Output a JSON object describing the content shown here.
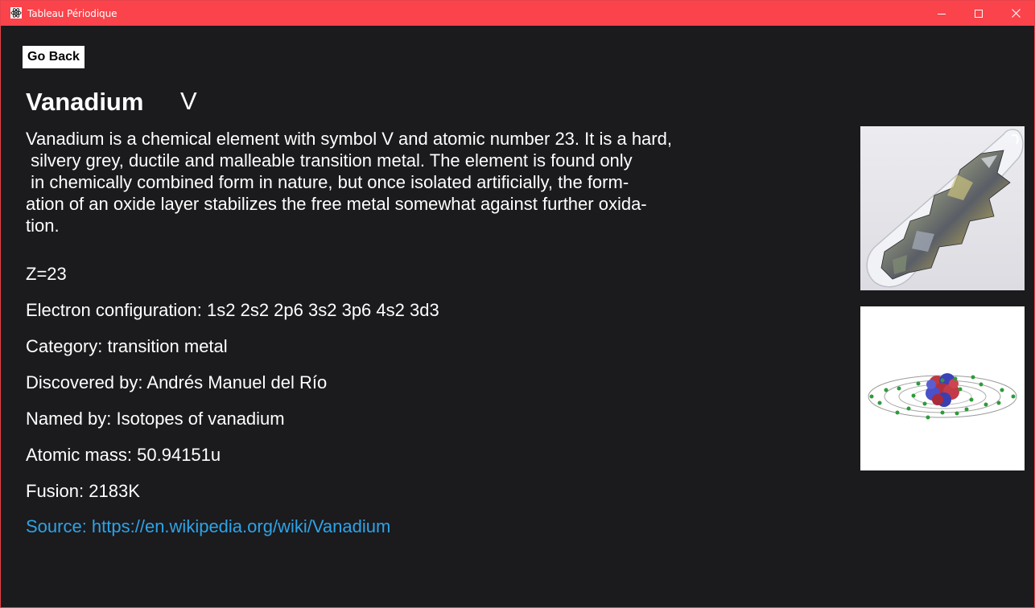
{
  "window": {
    "title": "Tableau Périodique",
    "accent_color": "#fb434b",
    "controls": [
      "minimize-icon",
      "maximize-icon",
      "close-icon"
    ]
  },
  "back_button": {
    "label": "Go Back"
  },
  "element": {
    "name": "Vanadium",
    "symbol": "V",
    "description": "Vanadium is a chemical element with symbol V and atomic number 23. It is a hard,\n silvery grey, ductile and malleable transition metal. The element is found only\n in chemically combined form in nature, but once isolated artificially, the form-\nation of an oxide layer stabilizes the free metal somewhat against further oxida-\ntion.",
    "properties": {
      "z": "Z=23",
      "electron_configuration": "Electron configuration: 1s2 2s2 2p6 3s2 3p6 4s2 3d3",
      "category": "Category: transition metal",
      "discovered_by": "Discovered by: Andrés Manuel del Río",
      "named_by": "Named by: Isotopes of vanadium",
      "atomic_mass": "Atomic mass: 50.94151u",
      "fusion": "Fusion: 2183K"
    },
    "source": "Source: https://en.wikipedia.org/wiki/Vanadium"
  },
  "images": {
    "photo": "vanadium-sample-photo",
    "model": "bohr-atom-model"
  },
  "link_color": "#2ea3e6"
}
